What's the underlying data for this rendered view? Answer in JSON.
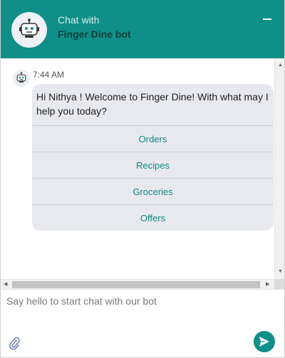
{
  "header": {
    "title_line1": "Chat with",
    "title_line2": "Finger Dine bot",
    "avatar_icon": "robot-icon",
    "minimize_icon": "minimize-icon"
  },
  "conversation": {
    "messages": [
      {
        "sender_icon": "robot-icon",
        "time": "7:44 AM",
        "text": "Hi Nithya ! Welcome to Finger Dine! With what may I help you today?",
        "options": [
          "Orders",
          "Recipes",
          "Groceries",
          "Offers"
        ]
      }
    ]
  },
  "composer": {
    "placeholder": "Say hello to start chat with our bot",
    "attach_icon": "paperclip-icon",
    "send_icon": "send-icon"
  },
  "colors": {
    "accent": "#0f8f87",
    "bubble": "#e8e9ee",
    "option_text": "#0f8a82"
  }
}
